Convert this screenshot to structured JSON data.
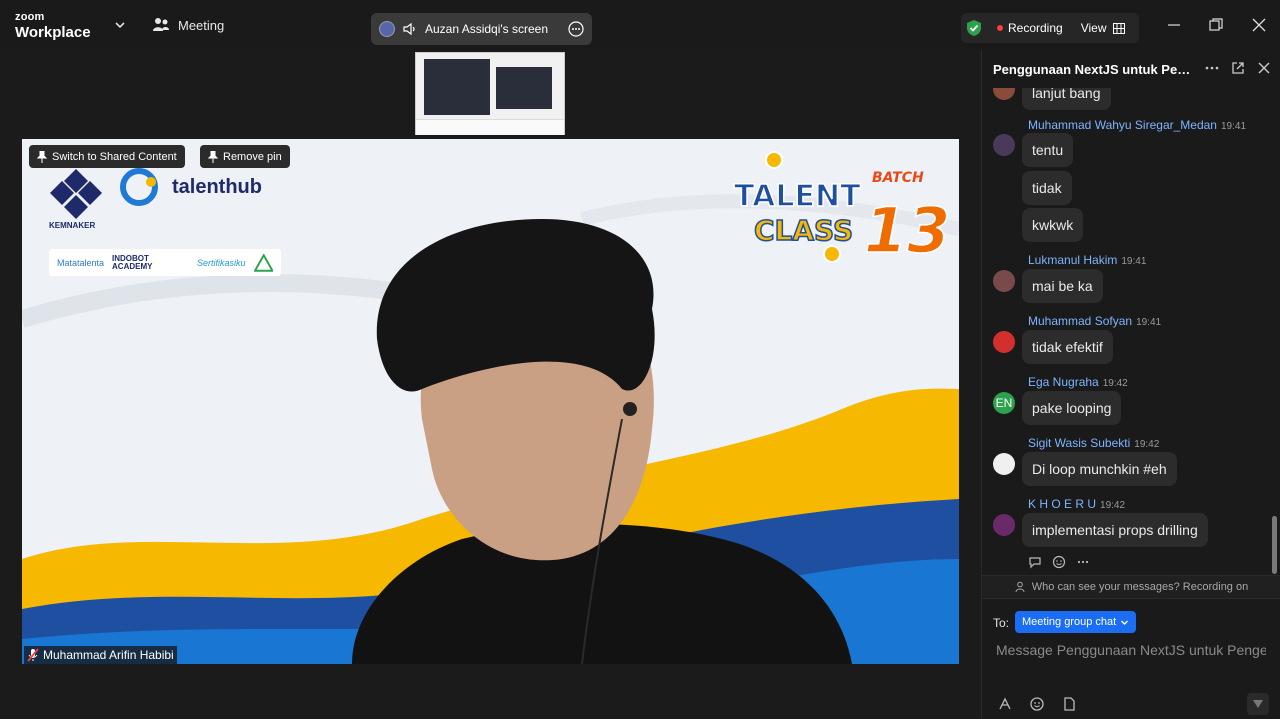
{
  "app": {
    "logo_top": "zoom",
    "logo_bottom": "Workplace"
  },
  "toolbar": {
    "meeting_label": "Meeting",
    "share_label": "Auzan Assidqi's screen",
    "recording_label": "Recording",
    "view_label": "View"
  },
  "video": {
    "switch_label": "Switch to Shared Content",
    "remove_pin_label": "Remove pin",
    "participant_name": "Muhammad Arifin Habibi",
    "brand_talenthub": "talenthub",
    "brand_kemnaker": "KEMNAKER",
    "partners": [
      "Matatalenta",
      "INDOBOT ACADEMY",
      "Sertifikasiku"
    ],
    "talent_class": {
      "line1": "TALENT",
      "line2": "CLASS",
      "batch_word": "BATCH",
      "batch_num": "13"
    }
  },
  "chat": {
    "title": "Penggunaan NextJS untuk Penge...",
    "messages": [
      {
        "sender": "",
        "time": "",
        "texts": [
          "lanjut bang"
        ]
      },
      {
        "sender": "Muhammad Wahyu Siregar_Medan",
        "time": "19:41",
        "texts": [
          "tentu",
          "tidak",
          "kwkwk"
        ]
      },
      {
        "sender": "Lukmanul Hakim",
        "time": "19:41",
        "texts": [
          "mai be ka"
        ]
      },
      {
        "sender": "Muhammad Sofyan",
        "time": "19:41",
        "texts": [
          "tidak efektif"
        ]
      },
      {
        "sender": "Ega Nugraha",
        "time": "19:42",
        "texts": [
          "pake looping"
        ],
        "avatar_initials": "EN"
      },
      {
        "sender": "Sigit Wasis Subekti",
        "time": "19:42",
        "texts": [
          "Di loop munchkin #eh"
        ]
      },
      {
        "sender": "K H O E R U",
        "time": "19:42",
        "texts": [
          "implementasi props drilling"
        ]
      }
    ],
    "visibility_note": "Who can see your messages? Recording on",
    "to_label": "To:",
    "recipient": "Meeting group chat",
    "input_placeholder": "Message Penggunaan NextJS untuk Penge..."
  },
  "colors": {
    "accent": "#1b6ef3",
    "sender": "#7db4ff",
    "recording": "#ff3b3b",
    "shield": "#2ca24e",
    "wave_yellow": "#f6b800",
    "wave_blue": "#1976d2"
  }
}
